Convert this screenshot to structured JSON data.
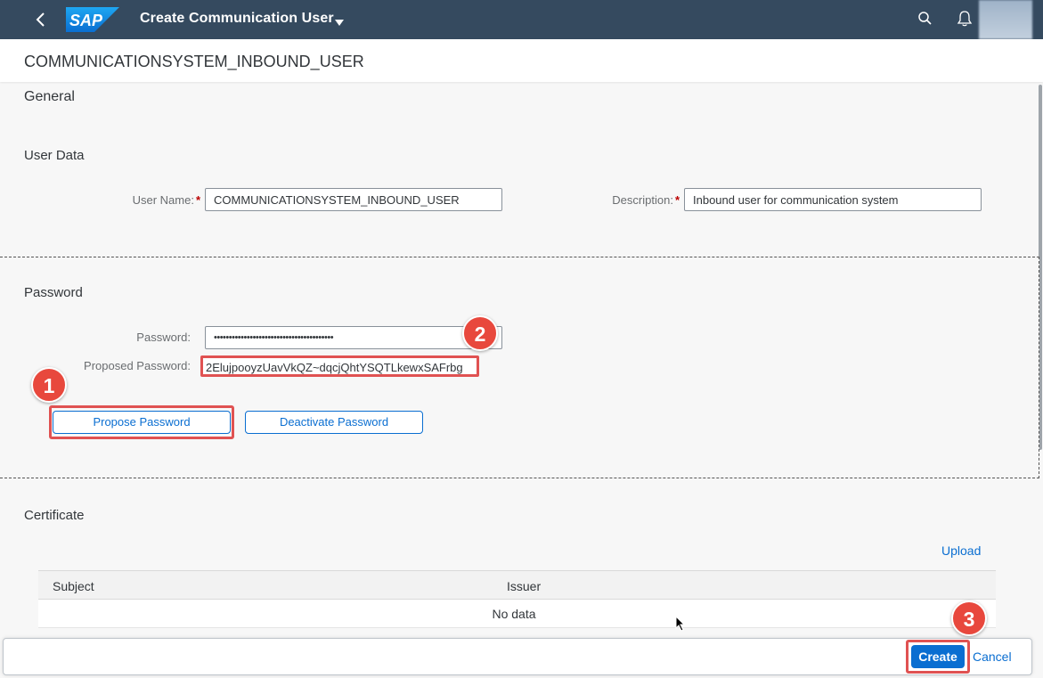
{
  "shell": {
    "logo_text": "SAP",
    "app_title": "Create Communication User",
    "icons": [
      "back-icon",
      "chevron-down-icon",
      "search-icon",
      "bell-icon",
      "avatar"
    ]
  },
  "header": {
    "title": "COMMUNICATIONSYSTEM_INBOUND_USER"
  },
  "general": {
    "title": "General"
  },
  "user_data": {
    "title": "User Data",
    "user_name_label": "User Name:",
    "user_name_value": "COMMUNICATIONSYSTEM_INBOUND_USER",
    "description_label": "Description:",
    "description_value": "Inbound user for communication system",
    "required_mark": "*"
  },
  "password": {
    "title": "Password",
    "password_label": "Password:",
    "password_value": "••••••••••••••••••••••••••••••••••••••••",
    "proposed_label": "Proposed Password:",
    "proposed_value": "2ElujpooyzUavVkQZ~dqcjQhtYSQTLkewxSAFrbg",
    "propose_button": "Propose Password",
    "deactivate_button": "Deactivate Password"
  },
  "certificate": {
    "title": "Certificate",
    "upload_link": "Upload",
    "columns": [
      "Subject",
      "Issuer"
    ],
    "empty_text": "No data"
  },
  "footer": {
    "create_button": "Create",
    "cancel_button": "Cancel"
  },
  "callouts": [
    "1",
    "2",
    "3"
  ],
  "colors": {
    "shell_bg": "#354a5f",
    "accent": "#0a6ed1",
    "callout": "#e8483d",
    "required": "#bb0000"
  }
}
